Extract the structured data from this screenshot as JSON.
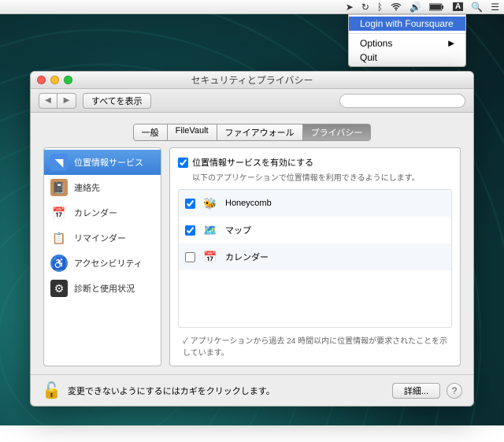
{
  "menubar": {
    "icons": [
      "location",
      "sync",
      "bluetooth",
      "wifi",
      "volume",
      "battery",
      "input",
      "spotlight",
      "menu"
    ]
  },
  "dropdown": {
    "login": "Login with Foursquare",
    "options": "Options",
    "quit": "Quit"
  },
  "window": {
    "title": "セキュリティとプライバシー",
    "show_all": "すべてを表示",
    "search_placeholder": ""
  },
  "tabs": {
    "general": "一般",
    "filevault": "FileVault",
    "firewall": "ファイアウォール",
    "privacy": "プライバシー"
  },
  "sidebar": {
    "items": [
      {
        "label": "位置情報サービス",
        "icon": "📍",
        "bg": "#4a8de8"
      },
      {
        "label": "連絡先",
        "icon": "👤",
        "bg": "#c98f5a"
      },
      {
        "label": "カレンダー",
        "icon": "📅",
        "bg": "#fff"
      },
      {
        "label": "リマインダー",
        "icon": "📋",
        "bg": "#fff"
      },
      {
        "label": "アクセシビリティ",
        "icon": "♿",
        "bg": "#3a7fd8"
      },
      {
        "label": "診断と使用状況",
        "icon": "🔧",
        "bg": "#333"
      }
    ]
  },
  "main": {
    "enable_label": "位置情報サービスを有効にする",
    "enable_desc": "以下のアプリケーションで位置情報を利用できるようにします。",
    "apps": [
      {
        "name": "Honeycomb",
        "checked": true,
        "icon": "🐝"
      },
      {
        "name": "マップ",
        "checked": true,
        "icon": "🗺️"
      },
      {
        "name": "カレンダー",
        "checked": false,
        "icon": "📅"
      }
    ],
    "legend": "✓ アプリケーションから過去 24 時間以内に位置情報が要求されたことを示しています。"
  },
  "footer": {
    "lock_text": "変更できないようにするにはカギをクリックします。",
    "advanced": "詳細..."
  }
}
